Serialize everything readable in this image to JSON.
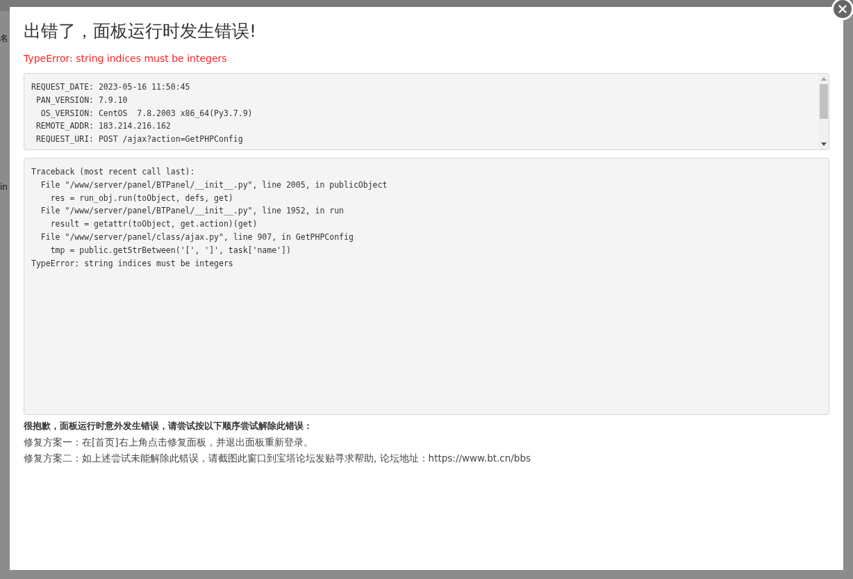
{
  "background": {
    "texts": [
      "名",
      "in"
    ]
  },
  "dialog": {
    "title": "出错了，面板运行时发生错误!",
    "error": "TypeError: string indices must be integers",
    "info_lines": [
      "REQUEST_DATE: 2023-05-16 11:50:45",
      " PAN_VERSION: 7.9.10",
      "  OS_VERSION: CentOS  7.8.2003 x86_64(Py3.7.9)",
      " REMOTE_ADDR: 183.214.216.162",
      " REQUEST_URI: POST /ajax?action=GetPHPConfig"
    ],
    "traceback_lines": [
      "Traceback (most recent call last):",
      "  File \"/www/server/panel/BTPanel/__init__.py\", line 2005, in publicObject",
      "    res = run_obj.run(toObject, defs, get)",
      "  File \"/www/server/panel/BTPanel/__init__.py\", line 1952, in run",
      "    result = getattr(toObject, get.action)(get)",
      "  File \"/www/server/panel/class/ajax.py\", line 907, in GetPHPConfig",
      "    tmp = public.getStrBetween('[', ']', task['name'])",
      "TypeError: string indices must be integers"
    ],
    "help": {
      "heading": "很抱歉，面板运行时意外发生错误，请尝试按以下顺序尝试解除此错误：",
      "lines": [
        "修复方案一：在[首页]右上角点击修复面板，并退出面板重新登录。",
        "修复方案二：如上述尝试未能解除此错误，请截图此窗口到宝塔论坛发贴寻求帮助, 论坛地址：https://www.bt.cn/bbs"
      ]
    }
  }
}
